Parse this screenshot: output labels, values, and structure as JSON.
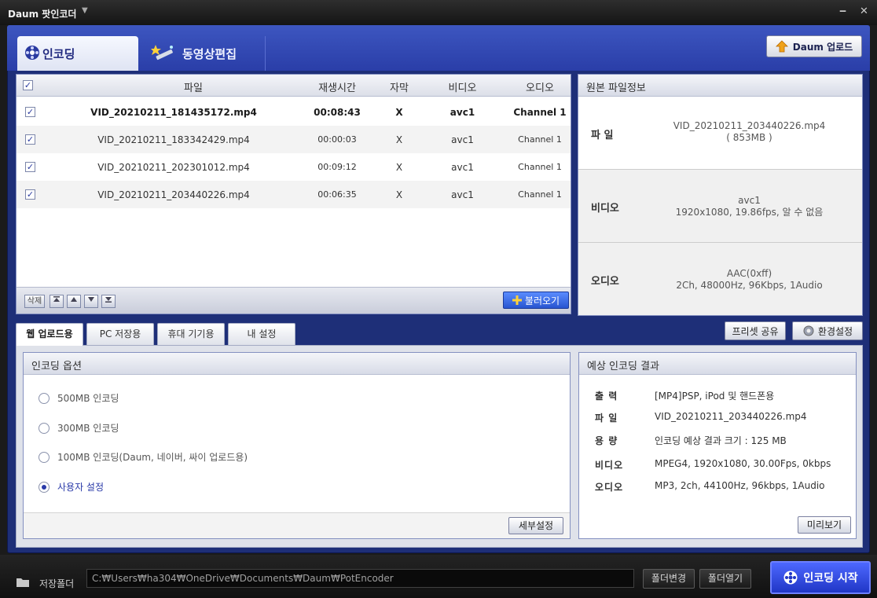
{
  "titlebar": {
    "app_title": "Daum 팟인코더",
    "menu_caret": "▼",
    "minimize": "‒",
    "close": "✕"
  },
  "main_tabs": [
    {
      "label": "인코딩",
      "icon": "film-reel-icon",
      "active": true
    },
    {
      "label": "동영상편집",
      "icon": "magic-wand-icon",
      "active": false
    }
  ],
  "upload_button": {
    "label": "Daum 업로드",
    "icon": "upload-arrow-icon"
  },
  "file_list": {
    "columns": [
      "파일",
      "재생시간",
      "자막",
      "비디오",
      "오디오"
    ],
    "rows": [
      {
        "file": "VID_20210211_181435172.mp4",
        "duration": "00:08:43",
        "subtitle": "X",
        "video": "avc1",
        "audio": "Channel 1",
        "checked": true,
        "bold": true
      },
      {
        "file": "VID_20210211_183342429.mp4",
        "duration": "00:00:03",
        "subtitle": "X",
        "video": "avc1",
        "audio": "Channel 1",
        "checked": true,
        "bold": false
      },
      {
        "file": "VID_20210211_202301012.mp4",
        "duration": "00:09:12",
        "subtitle": "X",
        "video": "avc1",
        "audio": "Channel 1",
        "checked": true,
        "bold": false
      },
      {
        "file": "VID_20210211_203440226.mp4",
        "duration": "00:06:35",
        "subtitle": "X",
        "video": "avc1",
        "audio": "Channel 1",
        "checked": true,
        "bold": false
      }
    ],
    "delete_label": "삭제",
    "load_label": "불러오기"
  },
  "source_info": {
    "title": "원본 파일정보",
    "file_label": "파  일",
    "file_name": "VID_20210211_203440226.mp4",
    "file_size": "( 853MB )",
    "video_label": "비디오",
    "video_codec": "avc1",
    "video_detail": "1920x1080, 19.86fps, 알 수 없음",
    "audio_label": "오디오",
    "audio_codec": "AAC(0xff)",
    "audio_detail": "2Ch, 48000Hz, 96Kbps, 1Audio"
  },
  "sub_tabs": [
    "웹 업로드용",
    "PC 저장용",
    "휴대 기기용",
    "내 설정"
  ],
  "preset_share_label": "프리셋 공유",
  "settings_label": "환경설정",
  "encoding_options": {
    "title": "인코딩 옵션",
    "options": [
      "500MB 인코딩",
      "300MB 인코딩",
      "100MB 인코딩(Daum, 네이버, 싸이 업로드용)",
      "사용자 설정"
    ],
    "selected": "사용자 설정",
    "detail_button": "세부설정"
  },
  "expected_result": {
    "title": "예상 인코딩 결과",
    "rows": [
      {
        "label": "출  력",
        "value": "[MP4]PSP, iPod 및 핸드폰용"
      },
      {
        "label": "파  일",
        "value": "VID_20210211_203440226.mp4"
      },
      {
        "label": "용  량",
        "value": "인코딩 예상 결과 크기 : 125 MB"
      },
      {
        "label": "비디오",
        "value": "MPEG4, 1920x1080, 30.00Fps, 0kbps"
      },
      {
        "label": "오디오",
        "value": "MP3, 2ch, 44100Hz, 96kbps, 1Audio"
      }
    ],
    "preview_button": "미리보기"
  },
  "bottom_bar": {
    "folder_label": "저장폴더",
    "path": "C:₩Users₩ha304₩OneDrive₩Documents₩Daum₩PotEncoder",
    "change_button": "폴더변경",
    "open_button": "폴더열기",
    "start_button": "인코딩 시작"
  },
  "colors": {
    "accent": "#2a3ea8",
    "start_button": "#2036c6",
    "frame": "#1e2f78"
  }
}
